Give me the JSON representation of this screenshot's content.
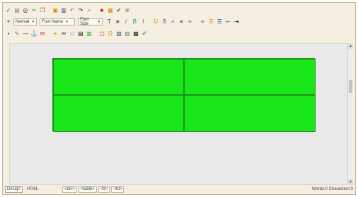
{
  "toolbar": {
    "row1": [
      {
        "name": "spellcheck-icon",
        "glyph": "✓"
      },
      {
        "name": "print-icon",
        "glyph": "▤"
      },
      {
        "name": "preview-icon",
        "glyph": "◎"
      },
      {
        "name": "cut-icon",
        "glyph": "✂"
      },
      {
        "name": "copy-icon",
        "glyph": "❐"
      },
      {
        "name": "paste-icon",
        "glyph": "▣"
      },
      {
        "name": "paste-word-icon",
        "glyph": "▥"
      },
      {
        "name": "undo-icon",
        "glyph": "↶"
      },
      {
        "name": "redo-icon",
        "glyph": "↷"
      },
      {
        "name": "find-icon",
        "glyph": "⌕"
      },
      {
        "name": "image-icon",
        "glyph": "■"
      },
      {
        "name": "table-icon",
        "glyph": "▦"
      },
      {
        "name": "check-icon",
        "glyph": "✔"
      },
      {
        "name": "cleanup-icon",
        "glyph": "⊗"
      }
    ],
    "font_style_select": {
      "label": "Normal"
    },
    "font_name_select": {
      "label": "Font Name"
    },
    "font_size_select": {
      "label": "Font Size"
    },
    "row2_buttons": [
      {
        "name": "text-color-icon",
        "glyph": "T"
      },
      {
        "name": "highlight-color-icon",
        "glyph": "■"
      },
      {
        "name": "link-icon",
        "glyph": "∕"
      },
      {
        "name": "bold-icon",
        "glyph": "B"
      },
      {
        "name": "italic-icon",
        "glyph": "I"
      },
      {
        "name": "underline-icon",
        "glyph": "U"
      },
      {
        "name": "strikethrough-icon",
        "glyph": "S"
      },
      {
        "name": "align-left-icon",
        "glyph": "≡"
      },
      {
        "name": "align-center-icon",
        "glyph": "≡"
      },
      {
        "name": "align-right-icon",
        "glyph": "≡"
      },
      {
        "name": "justify-icon",
        "glyph": "≡"
      },
      {
        "name": "ordered-list-icon",
        "glyph": "☰"
      },
      {
        "name": "unordered-list-icon",
        "glyph": "☰"
      },
      {
        "name": "outdent-icon",
        "glyph": "⇤"
      },
      {
        "name": "indent-icon",
        "glyph": "⇥"
      }
    ],
    "row3": [
      {
        "name": "style-icon",
        "glyph": "▪"
      },
      {
        "name": "edit-icon",
        "glyph": "✎"
      },
      {
        "name": "horizontal-rule-icon",
        "glyph": "—"
      },
      {
        "name": "anchor-icon",
        "glyph": "⚓"
      },
      {
        "name": "email-icon",
        "glyph": "✉"
      },
      {
        "name": "hyperlink-icon",
        "glyph": "⚭"
      },
      {
        "name": "unlink-icon",
        "glyph": "⚮"
      },
      {
        "name": "form-icon",
        "glyph": "▭"
      },
      {
        "name": "insert-row-icon",
        "glyph": "▤"
      },
      {
        "name": "insert-column-icon",
        "glyph": "▥"
      },
      {
        "name": "frame-icon",
        "glyph": "▢"
      },
      {
        "name": "special-char-icon",
        "glyph": "Ω"
      },
      {
        "name": "media-icon",
        "glyph": "▧"
      },
      {
        "name": "gallery-icon",
        "glyph": "▨"
      },
      {
        "name": "template-icon",
        "glyph": "▩"
      },
      {
        "name": "color-picker-icon",
        "glyph": "✐"
      }
    ]
  },
  "status": {
    "design_label": "Design",
    "html_label": "HTML",
    "path_tags": [
      "<div>",
      "<table>",
      "<tr>",
      "<td>"
    ],
    "word_count_text": "Words:0 Characters:0"
  },
  "colors": {
    "table_fill": "#19e619",
    "table_border": "#1c8f1c",
    "toolbar_bg": "#f4efe0",
    "edit_area_bg": "#e9e9e9"
  }
}
